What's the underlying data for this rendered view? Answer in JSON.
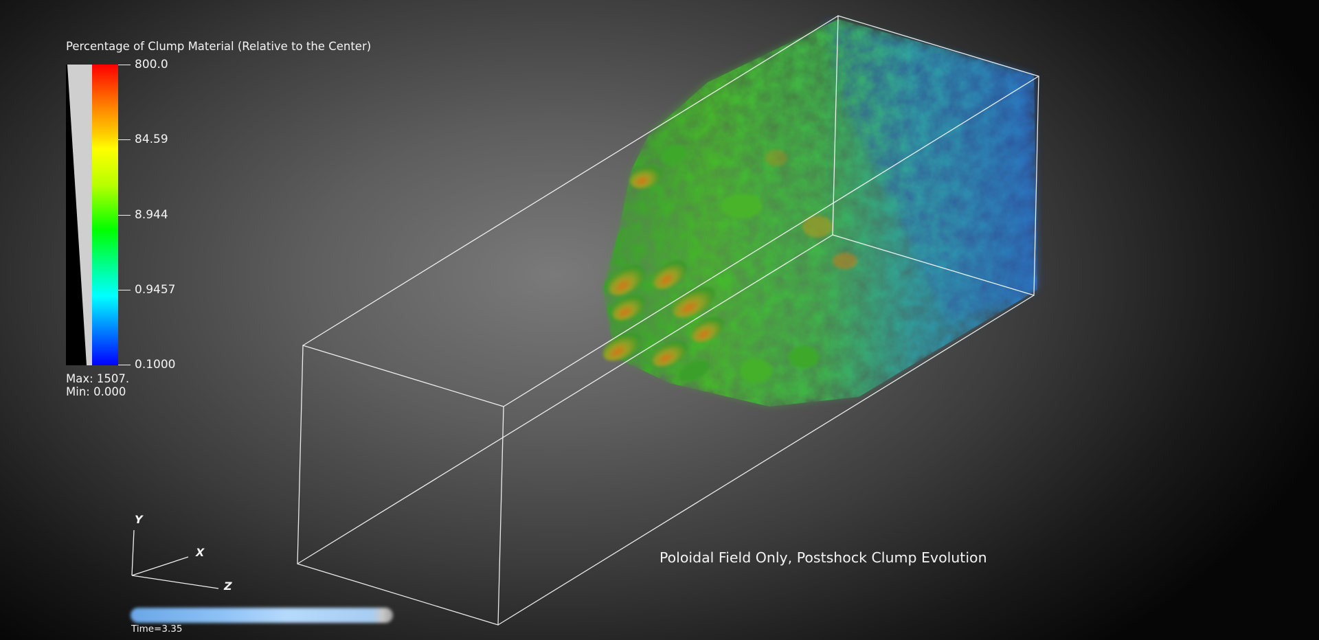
{
  "legend": {
    "title": "Percentage of Clump Material (Relative to the Center)",
    "ticks": [
      "800.0",
      "84.59",
      "8.944",
      "0.9457",
      "0.1000"
    ],
    "max_label": "Max:  1507.",
    "min_label": "Min:  0.000"
  },
  "caption": "Poloidal Field Only, Postshock Clump Evolution",
  "time": {
    "label": "Time=3.35"
  },
  "axes": {
    "x": "X",
    "y": "Y",
    "z": "Z"
  },
  "colors": {
    "background_center": "#7a7a7a",
    "background_edge": "#060606",
    "box_outline": "#ffffff",
    "colormap": [
      "#0000ff",
      "#00ffff",
      "#00ff00",
      "#ffff00",
      "#ff0000"
    ]
  }
}
